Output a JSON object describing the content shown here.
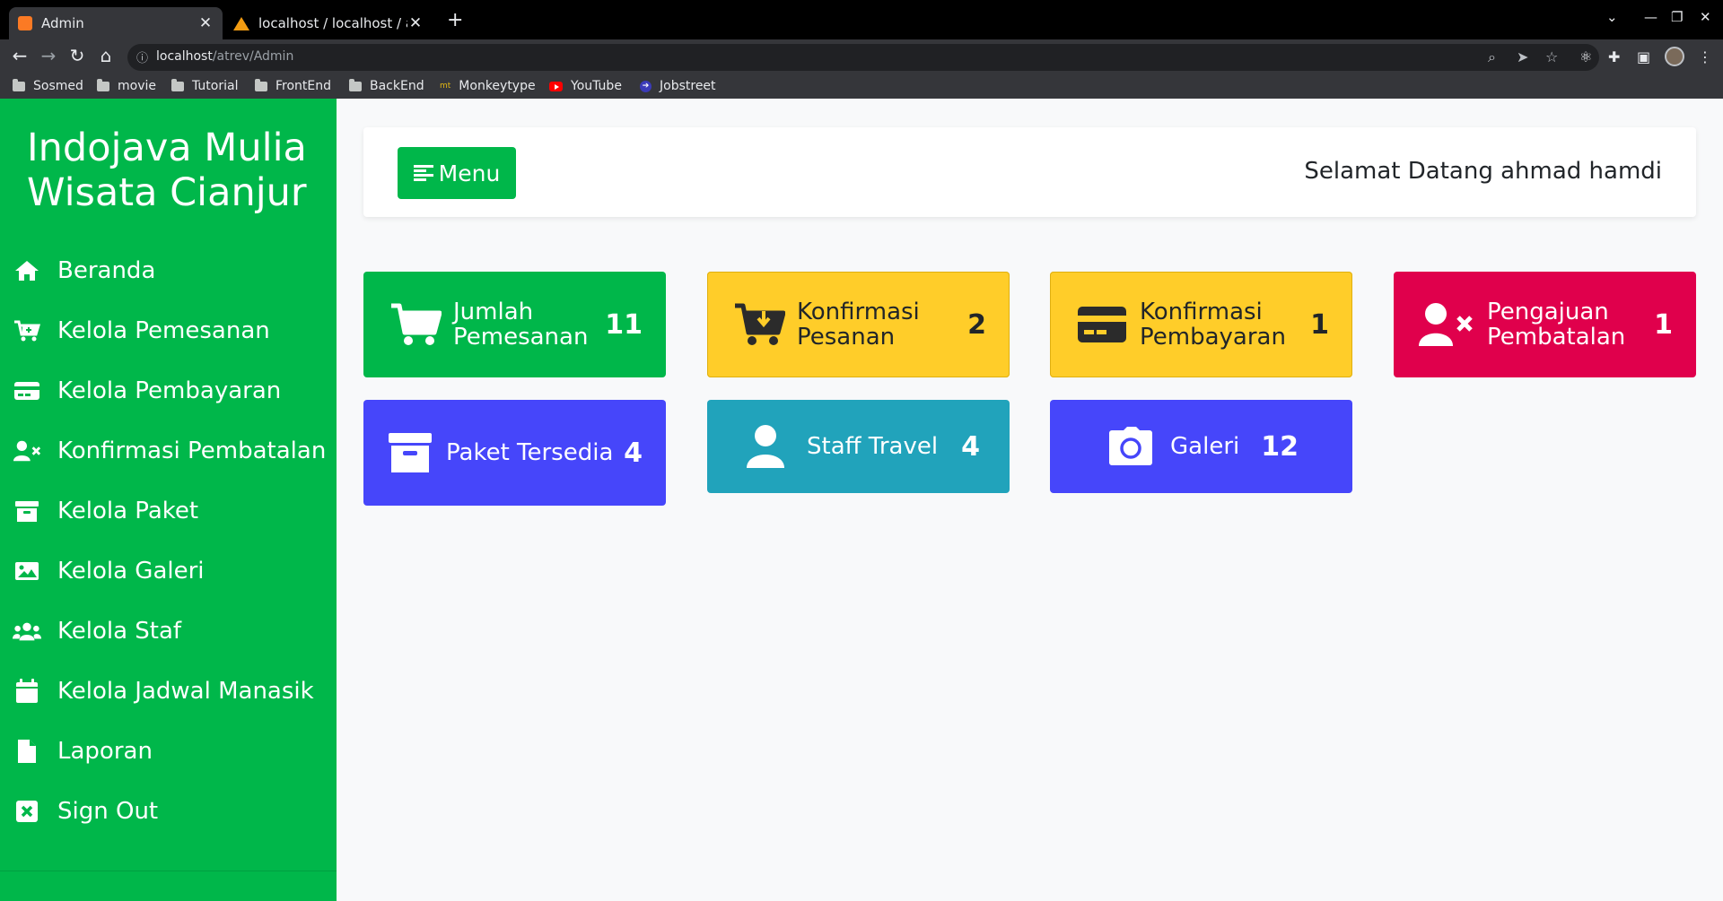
{
  "browser": {
    "tabs": [
      {
        "title": "Admin",
        "active": true
      },
      {
        "title": "localhost / localhost / atrev",
        "active": false
      }
    ],
    "address": {
      "host": "localhost",
      "path": "/atrev/Admin"
    },
    "bookmarks": [
      {
        "label": "Sosmed",
        "icon": "folder-icon"
      },
      {
        "label": "movie",
        "icon": "folder-icon"
      },
      {
        "label": "Tutorial",
        "icon": "folder-icon"
      },
      {
        "label": "FrontEnd",
        "icon": "folder-icon"
      },
      {
        "label": "BackEnd",
        "icon": "folder-icon"
      },
      {
        "label": "Monkeytype",
        "icon": "monkeytype-icon"
      },
      {
        "label": "YouTube",
        "icon": "youtube-icon"
      },
      {
        "label": "Jobstreet",
        "icon": "jobstreet-icon"
      }
    ]
  },
  "sidebar": {
    "brand": "Indojava Mulia Wisata Cianjur",
    "items": [
      {
        "label": "Beranda",
        "icon": "home-icon"
      },
      {
        "label": "Kelola Pemesanan",
        "icon": "cart-plus-icon"
      },
      {
        "label": "Kelola Pembayaran",
        "icon": "credit-card-icon"
      },
      {
        "label": "Konfirmasi Pembatalan",
        "icon": "user-x-icon"
      },
      {
        "label": "Kelola Paket",
        "icon": "archive-icon"
      },
      {
        "label": "Kelola Galeri",
        "icon": "image-icon"
      },
      {
        "label": "Kelola Staf",
        "icon": "users-icon"
      },
      {
        "label": "Kelola Jadwal Manasik",
        "icon": "calendar-icon"
      },
      {
        "label": "Laporan",
        "icon": "file-icon"
      },
      {
        "label": "Sign Out",
        "icon": "close-square-icon"
      }
    ]
  },
  "header": {
    "menu_label": "Menu",
    "welcome": "Selamat Datang ahmad hamdi"
  },
  "cards": [
    {
      "label": "Jumlah Pemesanan",
      "value": "11",
      "icon": "cart-icon",
      "color": "#00b74a"
    },
    {
      "label": "Konfirmasi Pesanan",
      "value": "2",
      "icon": "cart-download-icon",
      "color": "#ffcd29"
    },
    {
      "label": "Konfirmasi Pembayaran",
      "value": "1",
      "icon": "credit-card-icon",
      "color": "#ffcd29"
    },
    {
      "label": "Pengajuan Pembatalan",
      "value": "1",
      "icon": "user-x-icon",
      "color": "#e0004c"
    },
    {
      "label": "Paket Tersedia",
      "value": "4",
      "icon": "archive-icon",
      "color": "#4646fa"
    },
    {
      "label": "Staff Travel",
      "value": "4",
      "icon": "user-icon",
      "color": "#21a3bb"
    },
    {
      "label": "Galeri",
      "value": "12",
      "icon": "camera-icon",
      "color": "#4646fa"
    }
  ]
}
